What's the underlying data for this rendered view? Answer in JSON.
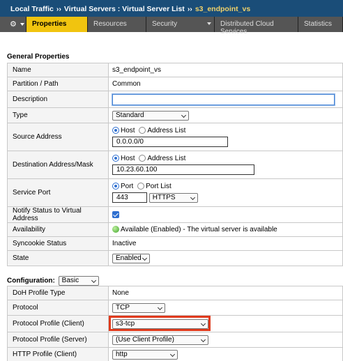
{
  "breadcrumb": {
    "items": [
      "Local Traffic",
      "Virtual Servers : Virtual Server List",
      "s3_endpoint_vs"
    ],
    "separator": "››"
  },
  "tabs": [
    {
      "label": "Properties",
      "active": true
    },
    {
      "label": "Resources",
      "active": false
    },
    {
      "label": "Security",
      "active": false,
      "dropdown": true
    },
    {
      "label": "Distributed Cloud Services",
      "active": false
    },
    {
      "label": "Statistics",
      "active": false
    }
  ],
  "general": {
    "title": "General Properties",
    "name": {
      "label": "Name",
      "value": "s3_endpoint_vs"
    },
    "partition": {
      "label": "Partition / Path",
      "value": "Common"
    },
    "description": {
      "label": "Description",
      "value": ""
    },
    "type": {
      "label": "Type",
      "value": "Standard"
    },
    "source": {
      "label": "Source Address",
      "opt_host": "Host",
      "opt_list": "Address List",
      "value": "0.0.0.0/0"
    },
    "destination": {
      "label": "Destination Address/Mask",
      "opt_host": "Host",
      "opt_list": "Address List",
      "value": "10.23.60.100"
    },
    "service_port": {
      "label": "Service Port",
      "opt_port": "Port",
      "opt_list": "Port List",
      "value": "443",
      "protocol": "HTTPS"
    },
    "notify": {
      "label": "Notify Status to Virtual Address",
      "checked": true
    },
    "availability": {
      "label": "Availability",
      "value": "Available (Enabled) - The virtual server is available"
    },
    "syncookie": {
      "label": "Syncookie Status",
      "value": "Inactive"
    },
    "state": {
      "label": "State",
      "value": "Enabled"
    }
  },
  "configuration": {
    "title": "Configuration:",
    "mode": "Basic",
    "doh": {
      "label": "DoH Profile Type",
      "value": "None"
    },
    "protocol": {
      "label": "Protocol",
      "value": "TCP"
    },
    "profile_client": {
      "label": "Protocol Profile (Client)",
      "value": "s3-tcp"
    },
    "profile_server": {
      "label": "Protocol Profile (Server)",
      "value": "(Use Client Profile)"
    },
    "http_client": {
      "label": "HTTP Profile (Client)",
      "value": "http"
    }
  },
  "colors": {
    "breadcrumb_bg": "#1a4d78",
    "breadcrumb_current": "#f1d26a",
    "tab_active": "#f1c40f",
    "highlight": "#e03a1c"
  }
}
